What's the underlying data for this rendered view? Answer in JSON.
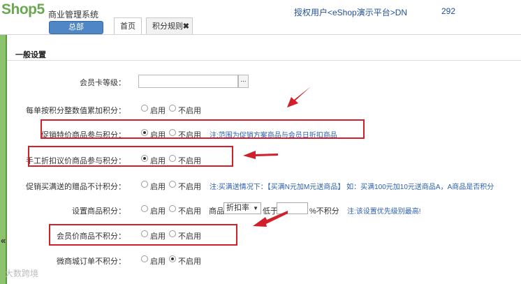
{
  "header": {
    "logo": "Shop5",
    "system_name": "商业管理系统",
    "hq_button": "总部",
    "tabs": [
      {
        "label": "首页"
      },
      {
        "label": "积分规则",
        "close": "✖"
      }
    ],
    "auth_user": "授权用户<eShop演示平台>DN",
    "auth_tail": "292"
  },
  "sidebar": {
    "collapse_glyph": "«"
  },
  "section_title": "一般设置",
  "radio_on": "启用",
  "radio_off": "不启用",
  "rows": {
    "member_level": {
      "label": "会员卡等级：",
      "value": "",
      "button": "..."
    },
    "per_order": {
      "label": "每单按积分整数值累加积分：",
      "selected": "none"
    },
    "promo_price": {
      "label": "促销特价商品参与积分：",
      "selected": "on",
      "note": "注:范围为促销方案商品与会员日折扣商品"
    },
    "manual_discount": {
      "label": "手工折扣议价商品参与积分：",
      "selected": "on"
    },
    "promo_gift": {
      "label": "促销买满送的赠品不计积分：",
      "selected": "none",
      "note": "注:买满送情况下：【买满N元加M元送商品】 如：买满100元加10元送商品A，A商品是否积分"
    },
    "product_points": {
      "label": "设置商品积分：",
      "selected": "none",
      "product_label": "商品",
      "select_value": "折扣率",
      "low_label": "低于",
      "low_value": "",
      "pct_label": "%不积分",
      "note": "注:该设置优先级别最高!"
    },
    "member_price": {
      "label": "会员价商品不积分：",
      "selected": "none"
    },
    "wechat_orders": {
      "label": "微商城订单不积分：",
      "selected": "off"
    }
  },
  "watermark": "大数跨境",
  "accent_colors": {
    "brand_green": "#6aa84f",
    "button_blue": "#4f86c6",
    "note_blue": "#2a5fb0",
    "annotation_red": "#d11f2b"
  },
  "icons": [
    "close-icon",
    "ellipsis-icon",
    "dropdown-arrow-icon",
    "collapse-icon",
    "annotation-arrow-icon"
  ]
}
